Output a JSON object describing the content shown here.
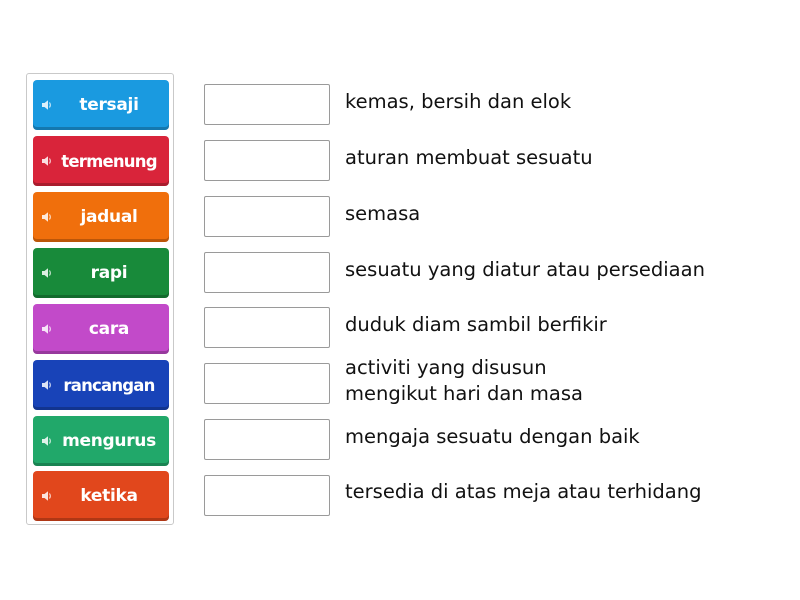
{
  "tiles": [
    {
      "label": "tersaji",
      "color": "#1a9ae0",
      "icon": "speaker-icon"
    },
    {
      "label": "termenung",
      "color": "#d9243a",
      "icon": "speaker-icon"
    },
    {
      "label": "jadual",
      "color": "#f06f0c",
      "icon": "speaker-icon"
    },
    {
      "label": "rapi",
      "color": "#188a3a",
      "icon": "speaker-icon"
    },
    {
      "label": "cara",
      "color": "#c24ac9",
      "icon": "speaker-icon"
    },
    {
      "label": "rancangan",
      "color": "#1843b8",
      "icon": "speaker-icon"
    },
    {
      "label": "mengurus",
      "color": "#21a86a",
      "icon": "speaker-icon"
    },
    {
      "label": "ketika",
      "color": "#e1471c",
      "icon": "speaker-icon"
    }
  ],
  "definitions": [
    {
      "line1": "kemas, bersih dan elok",
      "line2": ""
    },
    {
      "line1": "aturan membuat sesuatu",
      "line2": ""
    },
    {
      "line1": "semasa",
      "line2": ""
    },
    {
      "line1": "sesuatu yang diatur atau persediaan",
      "line2": ""
    },
    {
      "line1": "duduk diam sambil berfikir",
      "line2": ""
    },
    {
      "line1": "activiti yang disusun",
      "line2": "mengikut hari dan masa"
    },
    {
      "line1": "mengaja sesuatu dengan baik",
      "line2": ""
    },
    {
      "line1": "tersedia di atas meja atau terhidang",
      "line2": ""
    }
  ]
}
